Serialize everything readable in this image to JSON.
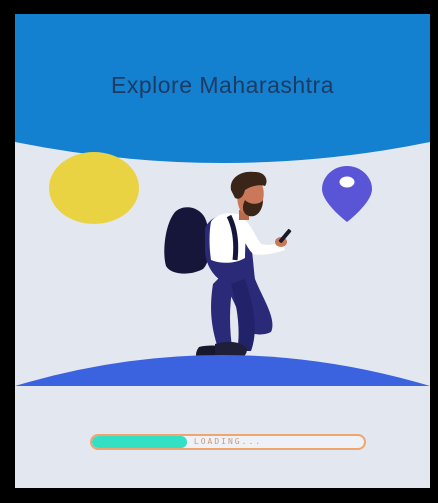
{
  "app": {
    "title": "Explore Maharashtra"
  },
  "loader": {
    "label": "LOADING...",
    "progress": 0.35
  },
  "illustration": {
    "icons": [
      "map-pin-icon",
      "sun-icon"
    ],
    "subject": "hiker-with-phone",
    "colors": {
      "header": "#1380d0",
      "background": "#e3e7ef",
      "ground": "#3c63df",
      "sun": "#ead342",
      "pin": "#5a55d6",
      "loader_fill": "#33e0c6",
      "loader_border": "#f0a56e"
    }
  }
}
